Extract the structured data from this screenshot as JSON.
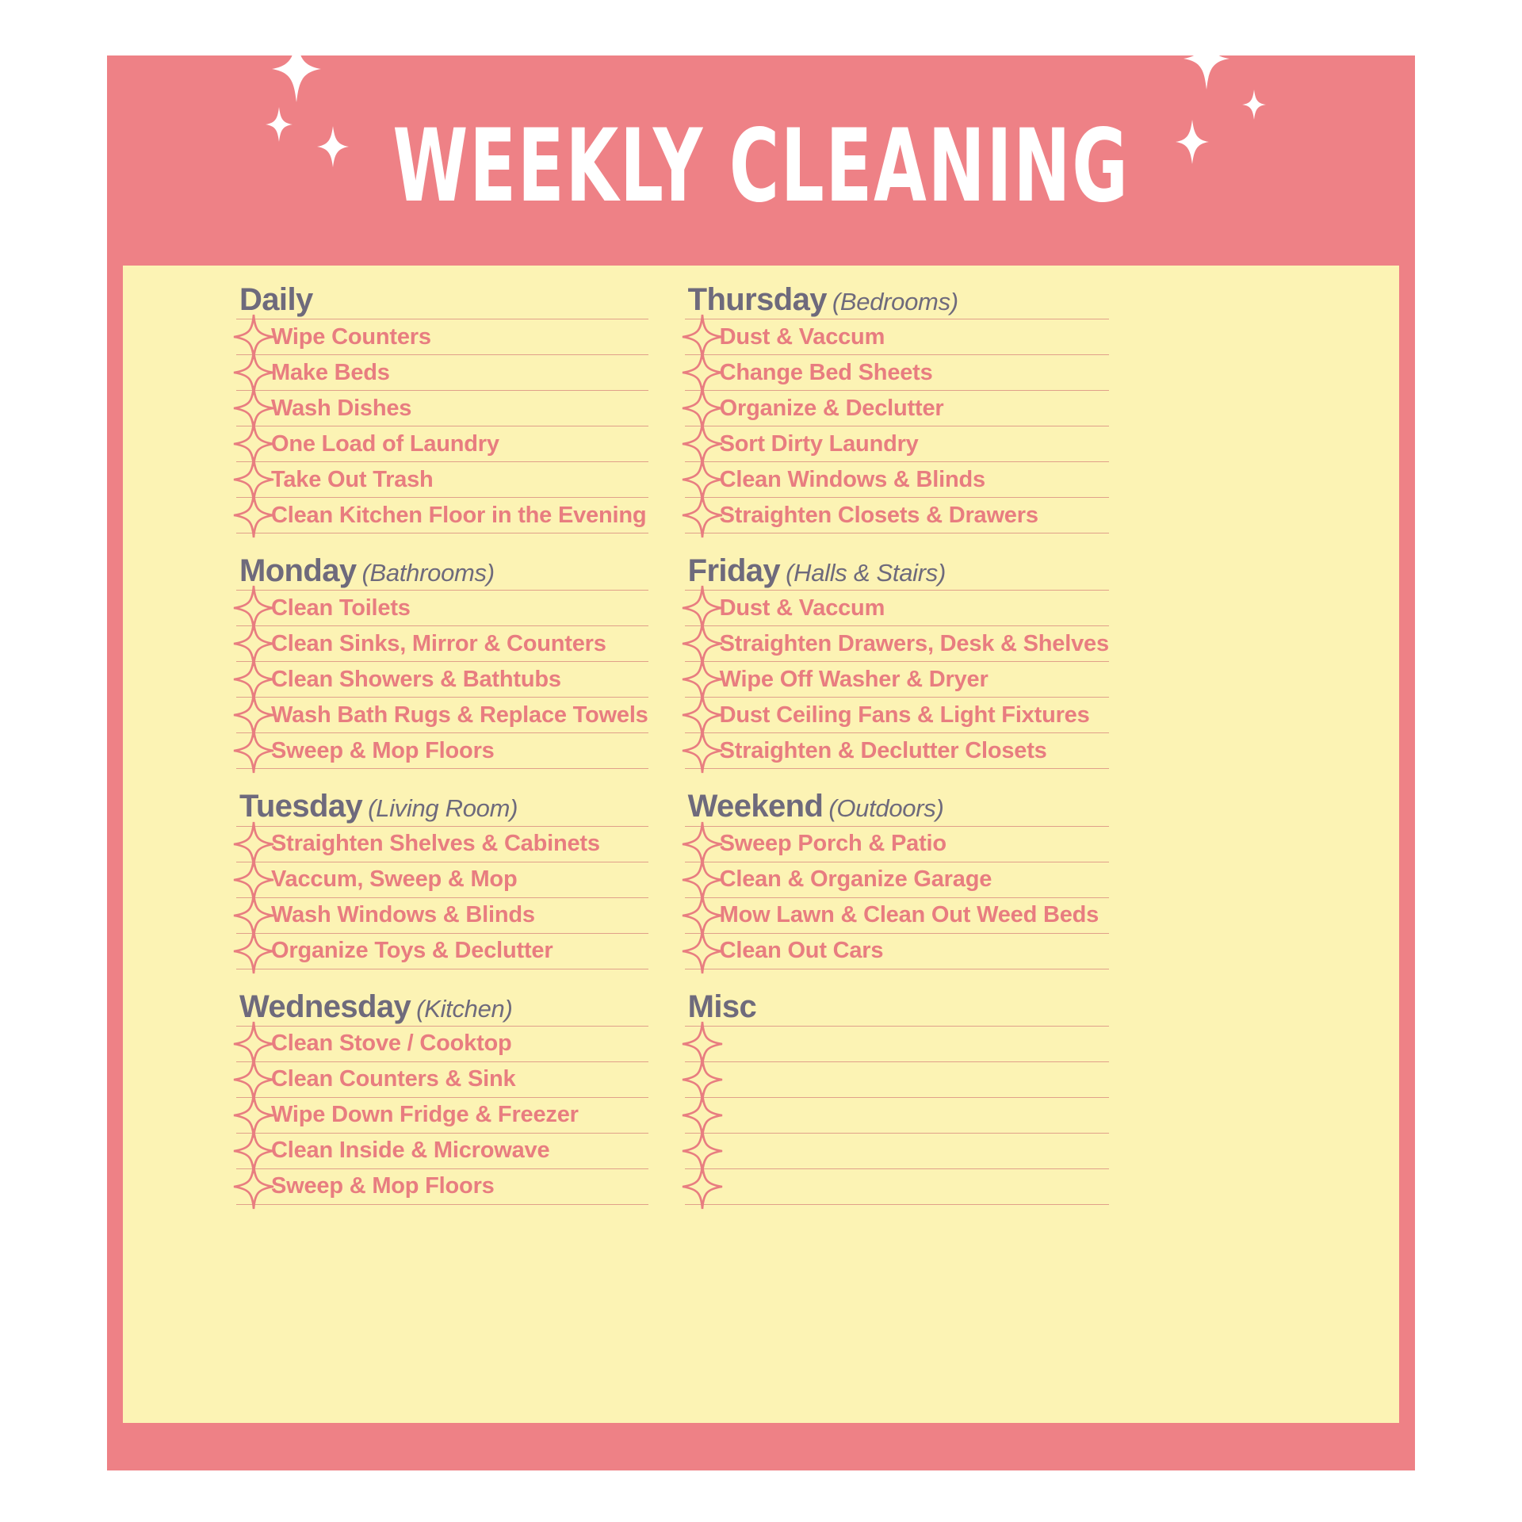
{
  "poster": {
    "title": "WEEKLY CLEANING",
    "colors": {
      "frame": "#ee8186",
      "sheet": "#fcf3b4",
      "heading": "#6e6a7c",
      "task": "#e87d80",
      "rule": "#e0a08a",
      "title_text": "#ffffff"
    },
    "decorations": [
      "sparkle-icon-large-left",
      "sparkle-icon-small-left",
      "sparkle-icon-tiny-left",
      "sparkle-icon-large-right",
      "sparkle-icon-small-right",
      "sparkle-icon-tiny-right"
    ]
  },
  "columns": [
    {
      "name": "left-column",
      "sections": [
        {
          "title": "Daily",
          "subtitle": "",
          "items": [
            "Wipe Counters",
            "Make Beds",
            "Wash Dishes",
            "One Load of Laundry",
            "Take Out Trash",
            "Clean Kitchen Floor in the Evening"
          ]
        },
        {
          "title": "Monday",
          "subtitle": "(Bathrooms)",
          "items": [
            "Clean Toilets",
            "Clean Sinks, Mirror & Counters",
            "Clean Showers & Bathtubs",
            "Wash Bath Rugs & Replace Towels",
            "Sweep & Mop Floors"
          ]
        },
        {
          "title": "Tuesday",
          "subtitle": "(Living Room)",
          "items": [
            "Straighten Shelves & Cabinets",
            "Vaccum, Sweep & Mop",
            "Wash Windows & Blinds",
            "Organize Toys & Declutter"
          ]
        },
        {
          "title": "Wednesday",
          "subtitle": "(Kitchen)",
          "items": [
            "Clean Stove / Cooktop",
            "Clean Counters & Sink",
            "Wipe Down Fridge & Freezer",
            "Clean Inside & Microwave",
            "Sweep & Mop Floors"
          ]
        }
      ]
    },
    {
      "name": "right-column",
      "sections": [
        {
          "title": "Thursday",
          "subtitle": "(Bedrooms)",
          "items": [
            "Dust & Vaccum",
            "Change Bed Sheets",
            "Organize & Declutter",
            "Sort Dirty Laundry",
            "Clean Windows & Blinds",
            "Straighten Closets & Drawers"
          ]
        },
        {
          "title": "Friday",
          "subtitle": "(Halls & Stairs)",
          "items": [
            "Dust & Vaccum",
            "Straighten Drawers, Desk & Shelves",
            "Wipe Off Washer & Dryer",
            "Dust Ceiling Fans & Light Fixtures",
            "Straighten & Declutter Closets"
          ]
        },
        {
          "title": "Weekend",
          "subtitle": "(Outdoors)",
          "items": [
            "Sweep Porch & Patio",
            "Clean & Organize Garage",
            "Mow Lawn & Clean Out Weed Beds",
            "Clean Out Cars"
          ]
        },
        {
          "title": "Misc",
          "subtitle": "",
          "items": [
            "",
            "",
            "",
            "",
            ""
          ]
        }
      ]
    }
  ]
}
